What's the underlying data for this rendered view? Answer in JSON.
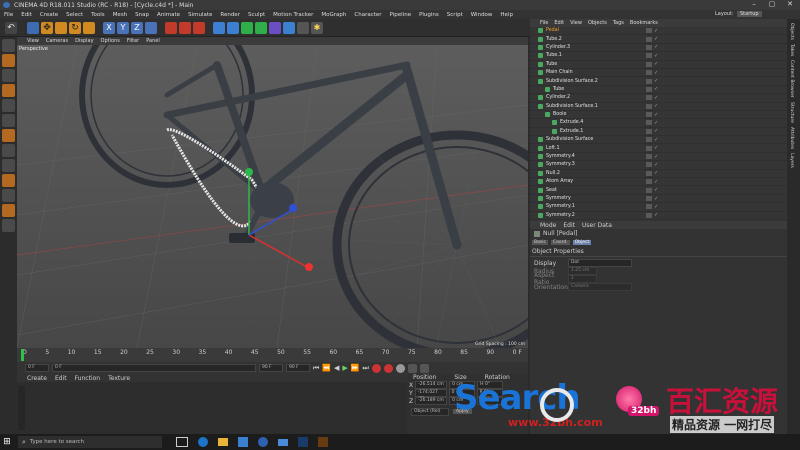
{
  "window": {
    "title": "CINEMA 4D R18.011 Studio (RC - R18) - [Cycle.c4d *] - Main",
    "layout_label": "Layout:",
    "layout_value": "Startup"
  },
  "menubar": [
    "File",
    "Edit",
    "Create",
    "Select",
    "Tools",
    "Mesh",
    "Snap",
    "Animate",
    "Simulate",
    "Render",
    "Sculpt",
    "Motion Tracker",
    "MoGraph",
    "Character",
    "Pipeline",
    "Plugins",
    "Script",
    "Window",
    "Help"
  ],
  "viewport": {
    "menu": [
      "View",
      "Cameras",
      "Display",
      "Options",
      "Filter",
      "Panel"
    ],
    "label": "Perspective",
    "grid_spacing": "Grid Spacing : 100 cm"
  },
  "timeline": {
    "ticks": [
      "0",
      "5",
      "10",
      "15",
      "20",
      "25",
      "30",
      "35",
      "40",
      "45",
      "50",
      "55",
      "60",
      "65",
      "70",
      "75",
      "80",
      "85",
      "90"
    ],
    "end_label": "0 F",
    "start_field": "0 F",
    "current_field": "0 F",
    "max_field": "90 F",
    "end_field": "90 F"
  },
  "material_manager": {
    "menu": [
      "Create",
      "Edit",
      "Function",
      "Texture"
    ]
  },
  "coordinates": {
    "headers": [
      "Position",
      "Size",
      "Rotation"
    ],
    "rows": [
      {
        "axis": "X",
        "pos": "-26.514 cm",
        "size": "0 cm",
        "rot": "H 0°"
      },
      {
        "axis": "Y",
        "pos": "-174.027 cm",
        "size": "0 cm",
        "rot": "P 0°"
      },
      {
        "axis": "Z",
        "pos": "-26.189 cm",
        "size": "0 cm",
        "rot": "B 0°"
      }
    ],
    "mode_button": "Object (Rel)",
    "apply_button": "Apply"
  },
  "object_manager": {
    "menu": [
      "File",
      "Edit",
      "View",
      "Objects",
      "Tags",
      "Bookmarks"
    ],
    "items": [
      {
        "name": "Pedal",
        "indent": 0,
        "color": "#f0a030"
      },
      {
        "name": "Tube.2",
        "indent": 0,
        "color": "#e0e0e0"
      },
      {
        "name": "Cylinder.3",
        "indent": 0,
        "color": "#e0e0e0"
      },
      {
        "name": "Tube.1",
        "indent": 0,
        "color": "#e0e0e0"
      },
      {
        "name": "Tube",
        "indent": 0,
        "color": "#e0e0e0"
      },
      {
        "name": "Main Chain",
        "indent": 0,
        "color": "#e0e0e0"
      },
      {
        "name": "Subdivision Surface.2",
        "indent": 0,
        "color": "#e0e0e0"
      },
      {
        "name": "Tube",
        "indent": 1,
        "color": "#e0e0e0"
      },
      {
        "name": "Cylinder.2",
        "indent": 0,
        "color": "#e0e0e0"
      },
      {
        "name": "Subdivision Surface.1",
        "indent": 0,
        "color": "#e0e0e0"
      },
      {
        "name": "Boole",
        "indent": 1,
        "color": "#e0e0e0"
      },
      {
        "name": "Extrude.4",
        "indent": 2,
        "color": "#e0e0e0"
      },
      {
        "name": "Extrude.1",
        "indent": 2,
        "color": "#e0e0e0"
      },
      {
        "name": "Subdivision Surface",
        "indent": 0,
        "color": "#e0e0e0"
      },
      {
        "name": "Loft.1",
        "indent": 0,
        "color": "#e0e0e0"
      },
      {
        "name": "Symmetry.4",
        "indent": 0,
        "color": "#e0e0e0"
      },
      {
        "name": "Symmetry.3",
        "indent": 0,
        "color": "#e0e0e0"
      },
      {
        "name": "Null.2",
        "indent": 0,
        "color": "#e0e0e0"
      },
      {
        "name": "Atom Array",
        "indent": 0,
        "color": "#e0e0e0"
      },
      {
        "name": "Seat",
        "indent": 0,
        "color": "#e0e0e0"
      },
      {
        "name": "Symmetry",
        "indent": 0,
        "color": "#e0e0e0"
      },
      {
        "name": "Symmetry.1",
        "indent": 0,
        "color": "#e0e0e0"
      },
      {
        "name": "Symmetry.2",
        "indent": 0,
        "color": "#e0e0e0"
      }
    ]
  },
  "attributes": {
    "menu": [
      "Mode",
      "Edit",
      "User Data"
    ],
    "object_title": "Null [Pedal]",
    "tabs": [
      "Basic",
      "Coord.",
      "Object"
    ],
    "section": "Object Properties",
    "props": [
      {
        "label": "Display",
        "value": "Dot"
      },
      {
        "label": "Radius",
        "value": "1.25 cm"
      },
      {
        "label": "Aspect Ratio",
        "value": "1"
      },
      {
        "label": "Orientation",
        "value": "Camera"
      }
    ]
  },
  "right_tabs": [
    "Objects",
    "Takes",
    "Content Browser",
    "Structure",
    "Attributes",
    "Layers"
  ],
  "taskbar": {
    "search_placeholder": "Type here to search"
  },
  "watermark": {
    "line1": "Search",
    "url": "www.32bh.com",
    "badge": "32bh",
    "cn_title": "百汇资源",
    "cn_sub": "精品资源 一网打尽"
  }
}
